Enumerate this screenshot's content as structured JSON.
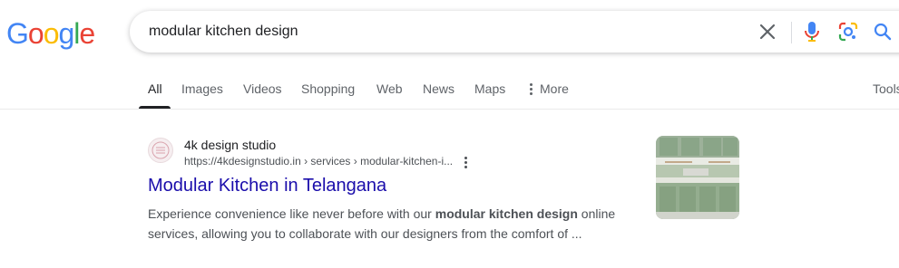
{
  "logo": {
    "letters": [
      "G",
      "o",
      "o",
      "g",
      "l",
      "e"
    ]
  },
  "search": {
    "query": "modular kitchen design"
  },
  "icons": {
    "clear": "close-icon",
    "voice": "microphone-icon",
    "lens": "google-lens-icon",
    "search": "search-icon",
    "more": "more-vertical-icon"
  },
  "colors": {
    "blue": "#4285f4",
    "red": "#ea4335",
    "yellow": "#fbbc05",
    "green": "#34a853",
    "link": "#1a0dab"
  },
  "tabs": [
    {
      "label": "All",
      "active": true
    },
    {
      "label": "Images"
    },
    {
      "label": "Videos"
    },
    {
      "label": "Shopping"
    },
    {
      "label": "Web"
    },
    {
      "label": "News"
    },
    {
      "label": "Maps"
    },
    {
      "label": "More"
    }
  ],
  "tools_label": "Tools",
  "result": {
    "site_name": "4k design studio",
    "url": "https://4kdesignstudio.in › services › modular-kitchen-i...",
    "title": "Modular Kitchen in Telangana",
    "snippet_before": "Experience convenience like never before with our ",
    "snippet_bold": "modular kitchen design",
    "snippet_after": " online services, allowing you to collaborate with our designers from the comfort of ..."
  }
}
